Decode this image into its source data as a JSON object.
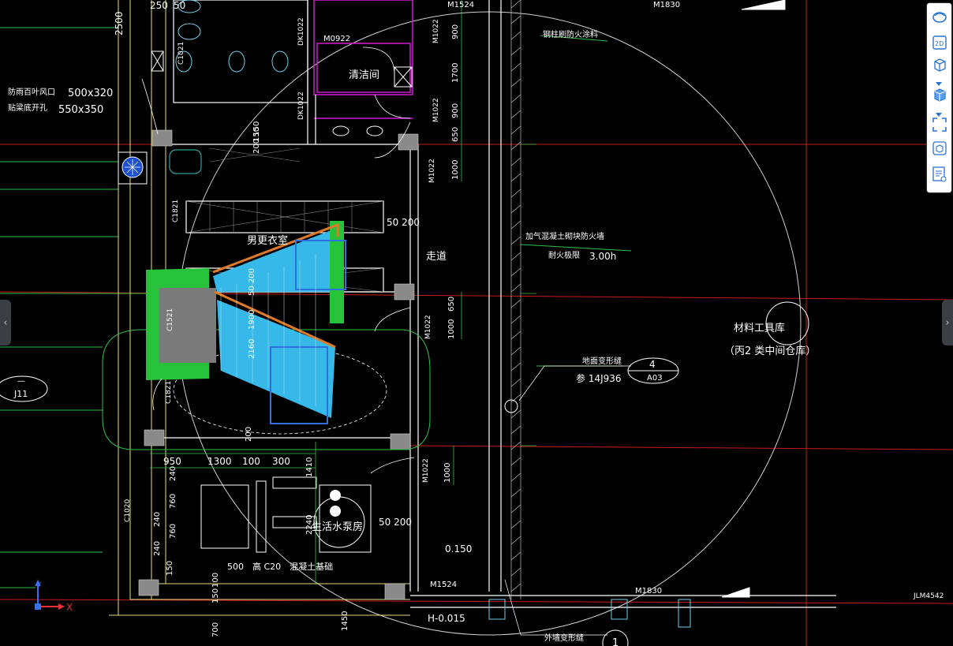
{
  "colors": {
    "background": "#000000",
    "wall": "#ffffff",
    "grid_red": "#c81a1a",
    "grid_green": "#2ec24a",
    "magenta": "#d01ad0",
    "yellow": "#e6e07a",
    "dim_text": "#ffffff",
    "stair_cyan": "#36b8e8",
    "stair_blue": "#2f6fe0",
    "stair_green": "#26c23a",
    "stair_orange": "#e07a26",
    "hatch": "#c0c0c0"
  },
  "labels": {
    "dim_250": "250",
    "dim_50": "50",
    "dim_2500": "2500",
    "m1524_top": "M1524",
    "m1830_top": "M1830",
    "m0922": "M0922",
    "dk1022_a": "DK1022",
    "dk1022_b": "DK1022",
    "m1022_a": "M1022",
    "m1022_b": "M1022",
    "m1022_c": "M1022",
    "m1022_d": "M1022",
    "m1022_e": "M1022",
    "c1021": "C1021",
    "c1821_a": "C1821",
    "c1821_b": "C1821",
    "c1521": "C1521",
    "c1020": "C1020",
    "steel_fire": "钢柱刷防火涂料",
    "clean_room": "清洁间",
    "vent_label": "防雨百叶风口",
    "vent_size": "500x320",
    "hole_label": "贴梁底开孔",
    "hole_size": "550x350",
    "locker_room": "男更衣室",
    "dim_50_200_a": "50 200",
    "corridor": "走道",
    "aerated_wall": "加气混凝土砌块防火墙",
    "fire_limit_label": "耐火极限",
    "fire_limit_value": "3.00h",
    "storeroom_name": "材料工具库",
    "storeroom_type": "（丙2 类中间仓库）",
    "joint_label": "地面变形缝",
    "joint_ref": "参 14J936",
    "detail_num": "4",
    "detail_sheet": "A03",
    "j11": "J11",
    "j11_top": "—",
    "dim_950": "950",
    "dim_1300": "1300",
    "dim_100": "100",
    "dim_300": "300",
    "pump_room": "生活水泵房",
    "dim_50_200_b": "50 200",
    "base_label": "500　高 C20　混凝土基础",
    "elev_0150": "0.150",
    "m1524_bot": "M1524",
    "elev_h": "H-0.015",
    "m1830_bot": "M1830",
    "jlm4542": "JLM4542",
    "outer_joint": "外墙变形缝",
    "detail_1": "1",
    "d_900_a": "900",
    "d_1700": "1700",
    "d_900_b": "900",
    "d_650_a": "650",
    "d_1000_a": "1000",
    "d_650_b": "650",
    "d_1000_b": "1000",
    "d_1000_c": "1000",
    "d_1410": "1410",
    "d_2240": "2240",
    "d_150_50": "150",
    "d_200_150": "200 150",
    "d_50_200": "50 200",
    "d_1900": "1900",
    "d_2160": "2160",
    "d_200_s": "200",
    "d_240_a": "240",
    "d_760_a": "760",
    "d_240_b": "240",
    "d_760_b": "760",
    "d_240_c": "240",
    "d_150": "150",
    "d_100_b": "100",
    "d_150_100": "150",
    "d_700": "700",
    "d_1450": "1450"
  },
  "toolbar": {
    "items": [
      {
        "name": "orbit-icon"
      },
      {
        "name": "view-2d-icon",
        "label": "2D"
      },
      {
        "name": "view-cube-icon"
      },
      {
        "name": "solid-cube-icon"
      },
      {
        "name": "fullscreen-icon"
      },
      {
        "name": "model-icon"
      },
      {
        "name": "properties-icon"
      }
    ]
  },
  "ucs": {
    "x_label": "X",
    "y_label": "Y"
  }
}
